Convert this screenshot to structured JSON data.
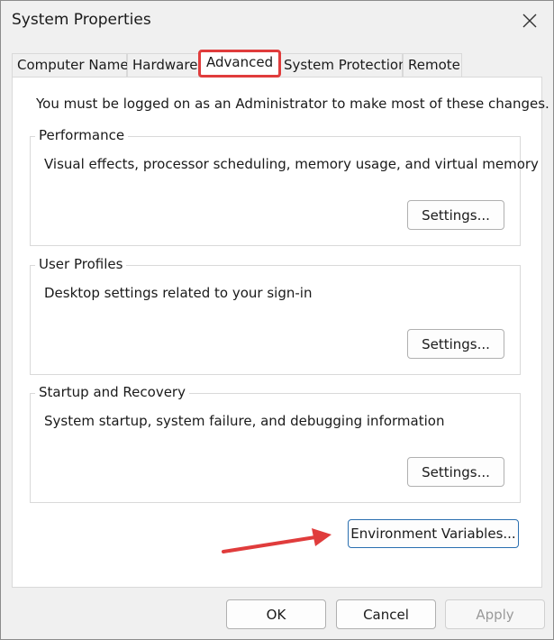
{
  "window": {
    "title": "System Properties"
  },
  "tabs": [
    {
      "label": "Computer Name",
      "active": false
    },
    {
      "label": "Hardware",
      "active": false
    },
    {
      "label": "Advanced",
      "active": true
    },
    {
      "label": "System Protection",
      "active": false
    },
    {
      "label": "Remote",
      "active": false
    }
  ],
  "advanced": {
    "notice": "You must be logged on as an Administrator to make most of these changes.",
    "performance": {
      "title": "Performance",
      "description": "Visual effects, processor scheduling, memory usage, and virtual memory",
      "button_label": "Settings..."
    },
    "user_profiles": {
      "title": "User Profiles",
      "description": "Desktop settings related to your sign-in",
      "button_label": "Settings..."
    },
    "startup_recovery": {
      "title": "Startup and Recovery",
      "description": "System startup, system failure, and debugging information",
      "button_label": "Settings..."
    },
    "env_button_label": "Environment Variables..."
  },
  "footer": {
    "ok_label": "OK",
    "cancel_label": "Cancel",
    "apply_label": "Apply"
  },
  "colors": {
    "highlight": "#e03c3c",
    "focus_border": "#2a6fb0"
  },
  "icons": {
    "close": "close-icon",
    "annotation": "red-arrow-icon"
  }
}
